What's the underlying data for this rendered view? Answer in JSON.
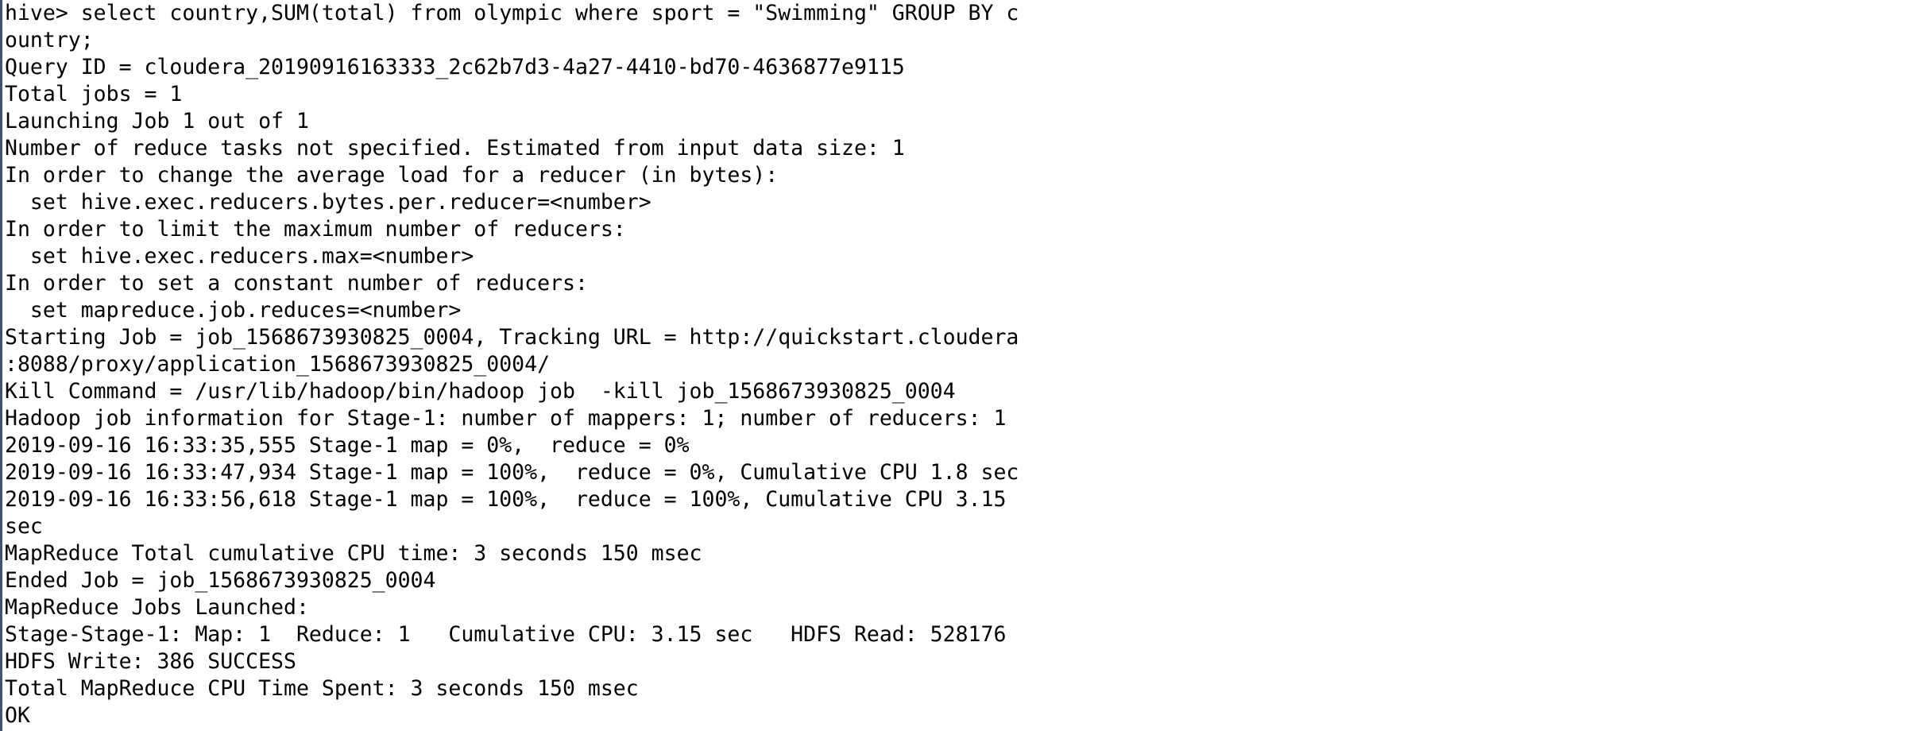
{
  "terminal": {
    "lines": [
      "hive> select country,SUM(total) from olympic where sport = \"Swimming\" GROUP BY c",
      "ountry;",
      "Query ID = cloudera_20190916163333_2c62b7d3-4a27-4410-bd70-4636877e9115",
      "Total jobs = 1",
      "Launching Job 1 out of 1",
      "Number of reduce tasks not specified. Estimated from input data size: 1",
      "In order to change the average load for a reducer (in bytes):",
      "  set hive.exec.reducers.bytes.per.reducer=<number>",
      "In order to limit the maximum number of reducers:",
      "  set hive.exec.reducers.max=<number>",
      "In order to set a constant number of reducers:",
      "  set mapreduce.job.reduces=<number>",
      "Starting Job = job_1568673930825_0004, Tracking URL = http://quickstart.cloudera",
      ":8088/proxy/application_1568673930825_0004/",
      "Kill Command = /usr/lib/hadoop/bin/hadoop job  -kill job_1568673930825_0004",
      "Hadoop job information for Stage-1: number of mappers: 1; number of reducers: 1",
      "2019-09-16 16:33:35,555 Stage-1 map = 0%,  reduce = 0%",
      "2019-09-16 16:33:47,934 Stage-1 map = 100%,  reduce = 0%, Cumulative CPU 1.8 sec",
      "2019-09-16 16:33:56,618 Stage-1 map = 100%,  reduce = 100%, Cumulative CPU 3.15",
      "sec",
      "MapReduce Total cumulative CPU time: 3 seconds 150 msec",
      "Ended Job = job_1568673930825_0004",
      "MapReduce Jobs Launched:",
      "Stage-Stage-1: Map: 1  Reduce: 1   Cumulative CPU: 3.15 sec   HDFS Read: 528176",
      "HDFS Write: 386 SUCCESS",
      "Total MapReduce CPU Time Spent: 3 seconds 150 msec",
      "OK"
    ]
  }
}
